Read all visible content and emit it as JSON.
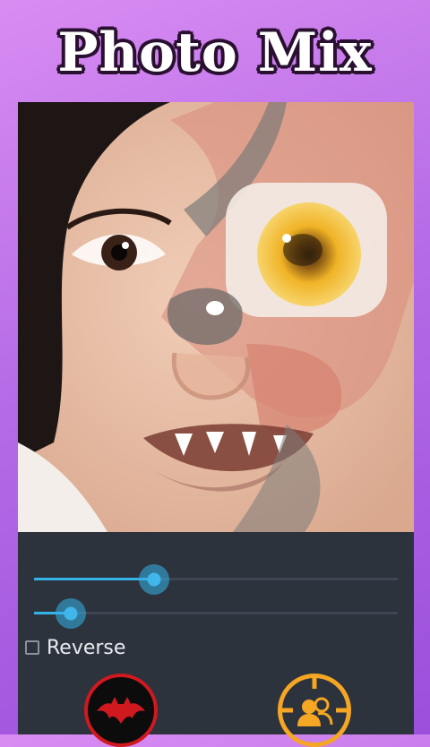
{
  "app": {
    "title": "Photo Mix"
  },
  "photo": {
    "description_icon": "face-mix-image"
  },
  "controls": {
    "slider_blend": {
      "value": 0.33
    },
    "slider_size": {
      "value": 0.1
    },
    "reverse": {
      "label": "Reverse",
      "checked": false
    }
  },
  "buttons": {
    "mask_icon": "bat-icon",
    "swap_icon": "users-target-icon"
  },
  "colors": {
    "accent": "#35b2e8",
    "panel": "#2c333d",
    "bat_ring": "#d0191f",
    "swap_ring": "#f5a623"
  }
}
